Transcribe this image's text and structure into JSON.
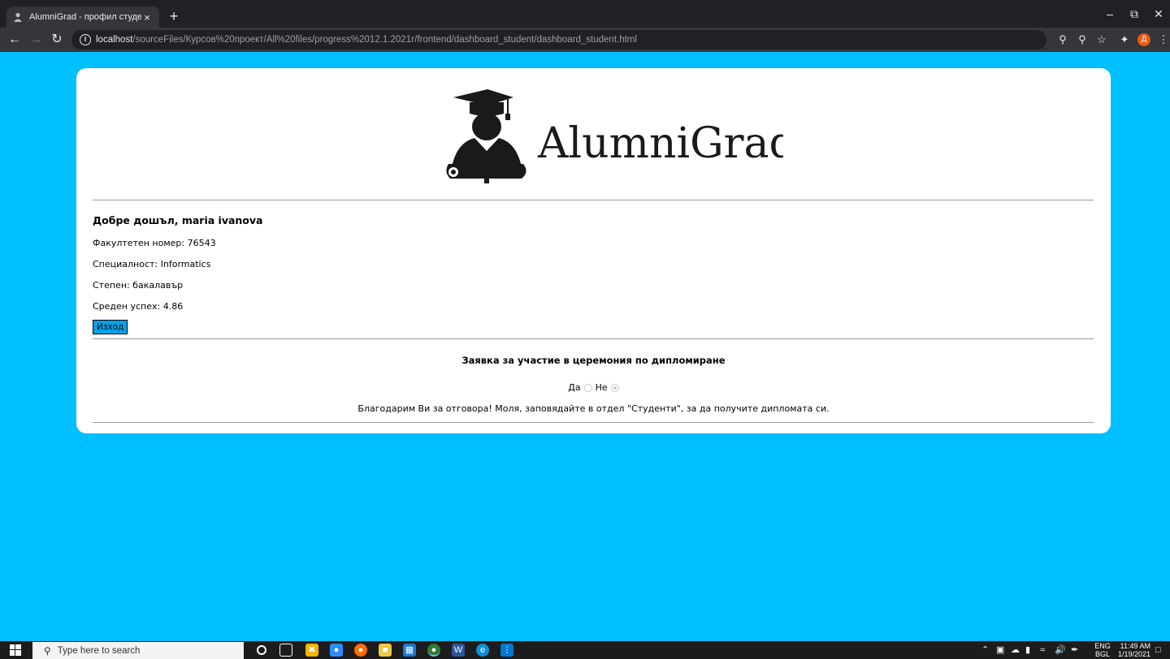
{
  "browser": {
    "tab_title": "AlumniGrad - профил студент",
    "tab_close": "×",
    "new_tab": "+",
    "url_host": "localhost",
    "url_path": "/sourceFiles/Курсов%20проект/All%20files/progress%2012.1.2021г/frontend/dashboard_student/dashboard_student.html",
    "profile_initial": "Д"
  },
  "logo": {
    "text": "AlumniGrad"
  },
  "profile": {
    "welcome": "Добре дошъл, maria ivanova",
    "faculty_number": "Факултетен номер: 76543",
    "specialty": "Специалност: Informatics",
    "degree": "Степен: бакалавър",
    "gpa": "Среден успех: 4.86",
    "exit_label": "Изход"
  },
  "ceremony": {
    "title": "Заявка за участие в церемония по дипломиране",
    "yes_label": "Да",
    "no_label": "Не",
    "selected": "no",
    "thanks": "Благодарим Ви за отговора! Моля, заповядайте в отдел \"Студенти\", за да получите дипломата си."
  },
  "taskbar": {
    "search_placeholder": "Type here to search",
    "lang_top": "ENG",
    "lang_bottom": "BGL",
    "time": "11:49 AM",
    "date": "1/19/2021"
  }
}
